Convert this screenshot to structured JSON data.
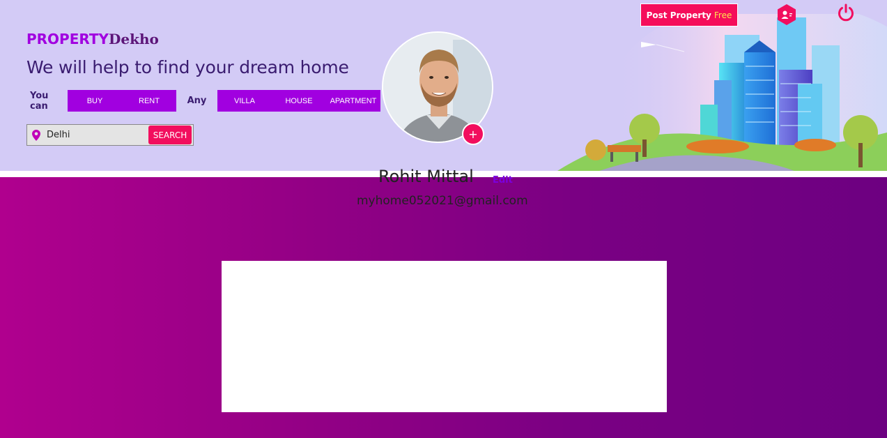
{
  "brand": {
    "part1": "PROPERTY",
    "part2": "Dekho"
  },
  "hero": {
    "tagline": "We will help to find your dream home"
  },
  "filters": {
    "you_can_label": "You can",
    "actions": [
      "BUY",
      "RENT"
    ],
    "any_label": "Any",
    "types": [
      "VILLA",
      "HOUSE",
      "APARTMENT"
    ]
  },
  "search": {
    "value": "Delhi",
    "button_label": "SEARCH",
    "icon": "map-pin-icon"
  },
  "topbar": {
    "post_label": "Post Property",
    "post_free": "Free",
    "user_icon": "user-icon",
    "power_icon": "power-icon"
  },
  "profile": {
    "name": "Rohit Mittal",
    "edit_label": "Edit",
    "email": "myhome052021@gmail.com",
    "add_label": "+"
  },
  "colors": {
    "header_bg": "#d3cbf6",
    "brand_purple": "#a100e0",
    "accent_pink": "#f20e5e",
    "section_gradient_start": "#b0008e",
    "section_gradient_end": "#6d0081"
  }
}
